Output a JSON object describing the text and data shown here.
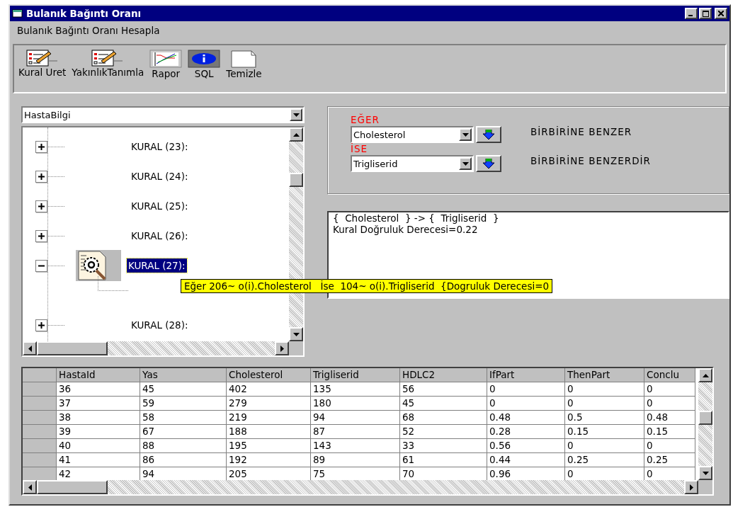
{
  "window": {
    "title": "Bulanık Bağıntı Oranı"
  },
  "menu": [
    {
      "label": "Bulanık Bağıntı Oranı Hesapla"
    }
  ],
  "toolbar": [
    {
      "label": "Kural Uret",
      "kind": "checklist"
    },
    {
      "label": "YakınlıkTanımla",
      "kind": "checklist"
    },
    {
      "label": "Rapor",
      "kind": "chart"
    },
    {
      "label": "SQL",
      "kind": "info"
    },
    {
      "label": "Temizle",
      "kind": "page"
    }
  ],
  "table_combo": {
    "value": "HastaBilgi"
  },
  "tree": [
    {
      "label": "KURAL (23):",
      "expanded": false,
      "selected": false
    },
    {
      "label": "KURAL (24):",
      "expanded": false,
      "selected": false
    },
    {
      "label": "KURAL (25):",
      "expanded": false,
      "selected": false
    },
    {
      "label": "KURAL (26):",
      "expanded": false,
      "selected": false
    },
    {
      "label": "KURAL (27):",
      "expanded": true,
      "selected": true
    },
    {
      "label": "KURAL (28):",
      "expanded": false,
      "selected": false
    }
  ],
  "tooltip": "Eğer 206~ o(i).Cholesterol   İse  104~ o(i).Trigliserid  {Dogruluk Derecesi=0",
  "rule": {
    "if_label": "EĞER",
    "if_field": "Cholesterol",
    "if_text": "BİRBİRİNE BENZER",
    "then_label": "İSE",
    "then_field": "Trigliserid",
    "then_text": "BİRBİRİNE BENZERDİR"
  },
  "result": [
    "{  Cholesterol  } -> {  Trigliserid  }",
    "Kural Doğruluk Derecesi=0.22"
  ],
  "table": {
    "columns": [
      "HastaId",
      "Yas",
      "Cholesterol",
      "Trigliserid",
      "HDLC2",
      "IfPart",
      "ThenPart",
      "Conclu"
    ],
    "rows": [
      [
        "36",
        "45",
        "402",
        "135",
        "56",
        "0",
        "0",
        "0"
      ],
      [
        "37",
        "59",
        "279",
        "180",
        "45",
        "0",
        "0",
        "0"
      ],
      [
        "38",
        "58",
        "219",
        "94",
        "68",
        "0.48",
        "0.5",
        "0.48"
      ],
      [
        "39",
        "67",
        "188",
        "87",
        "52",
        "0.28",
        "0.15",
        "0.15"
      ],
      [
        "40",
        "88",
        "195",
        "143",
        "33",
        "0.56",
        "0",
        "0"
      ],
      [
        "41",
        "86",
        "192",
        "89",
        "61",
        "0.44",
        "0.25",
        "0.25"
      ],
      [
        "42",
        "94",
        "205",
        "75",
        "70",
        "0.96",
        "0",
        "0"
      ]
    ]
  }
}
